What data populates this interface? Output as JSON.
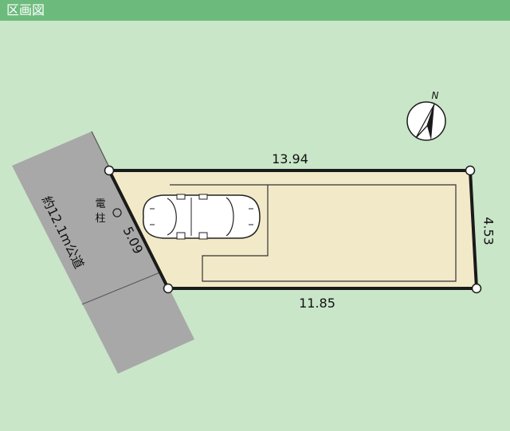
{
  "header": {
    "title": "区画図"
  },
  "lot": {
    "edges": {
      "top": "13.94",
      "right": "4.53",
      "bottom": "11.85",
      "left": "5.09"
    }
  },
  "road": {
    "label": "約12.1m公道"
  },
  "pole": {
    "label_line1": "電",
    "label_line2": "柱"
  },
  "compass": {
    "north_label": "N"
  },
  "colors": {
    "header": "#6cbb7c",
    "background": "#c9e6c8",
    "lot_fill": "#f2e9c8",
    "road": "#a8a8a8"
  }
}
